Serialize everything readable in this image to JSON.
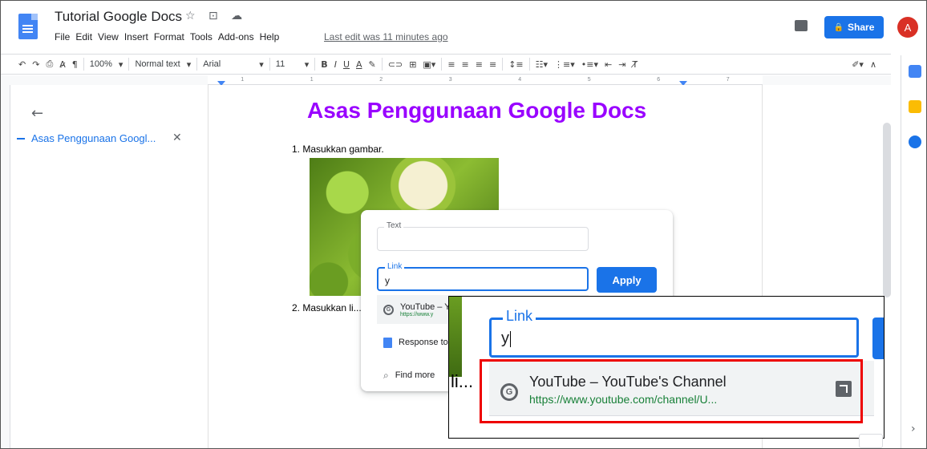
{
  "app": {
    "doc_title": "Tutorial Google Docs",
    "title_icons": "☆ ⊡ ☁",
    "menu": [
      "File",
      "Edit",
      "View",
      "Insert",
      "Format",
      "Tools",
      "Add-ons",
      "Help"
    ],
    "last_edit": "Last edit was 11 minutes ago",
    "share_label": "Share",
    "avatar_letter": "A"
  },
  "toolbar": {
    "zoom": "100%",
    "style": "Normal text",
    "font": "Arial",
    "font_size": "11",
    "bold": "B",
    "italic": "I",
    "underline": "U",
    "text_color": "A"
  },
  "ruler": {
    "numbers": [
      "1",
      "1",
      "2",
      "3",
      "4",
      "5",
      "6",
      "7"
    ]
  },
  "outline": {
    "back_arrow": "←",
    "item": "Asas Penggunaan Googl...",
    "close": "✕"
  },
  "document": {
    "heading": "Asas Penggunaan Google Docs",
    "list_1": "1.  Masukkan gambar.",
    "list_2": "2.  Masukkan li..."
  },
  "link_dialog": {
    "text_label": "Text",
    "text_value": "",
    "link_label": "Link",
    "link_value": "y",
    "apply_label": "Apply",
    "suggestions": [
      {
        "icon": "google-icon",
        "title": "YouTube – Y",
        "sub": "https://www.y"
      },
      {
        "icon": "doc-icon",
        "title": "Response to"
      },
      {
        "icon": "search-icon",
        "title": "Find more"
      }
    ]
  },
  "zoom_callout": {
    "behind_text": "li...",
    "link_label": "Link",
    "link_value": "y",
    "suggestion_title": "YouTube – YouTube's Channel",
    "suggestion_url": "https://www.youtube.com/channel/U..."
  },
  "colors": {
    "accent": "#1a73e8",
    "heading": "#9900ff",
    "highlight_border": "#ee0000",
    "url_green": "#188038"
  }
}
